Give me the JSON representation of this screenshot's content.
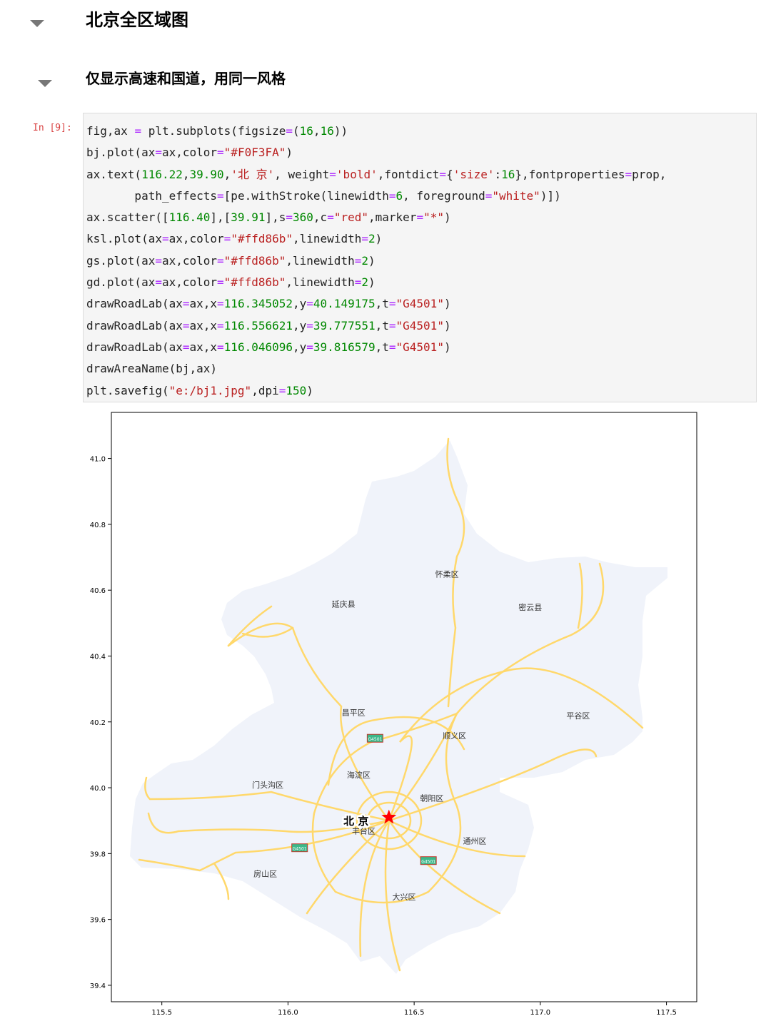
{
  "notebook": {
    "heading1": "北京全区域图",
    "heading2": "仅显示高速和国道，用同一风格",
    "prompt": "In [9]:",
    "code_lines": [
      "fig,ax = plt.subplots(figsize=(16,16))",
      "bj.plot(ax=ax,color=\"#F0F3FA\")",
      "ax.text(116.22,39.90,'北 京', weight='bold',fontdict={'size':16},fontproperties=prop,",
      "       path_effects=[pe.withStroke(linewidth=6, foreground=\"white\")])",
      "ax.scatter([116.40],[39.91],s=360,c=\"red\",marker=\"*\")",
      "ksl.plot(ax=ax,color=\"#ffd86b\",linewidth=2)",
      "gs.plot(ax=ax,color=\"#ffd86b\",linewidth=2)",
      "gd.plot(ax=ax,color=\"#ffd86b\",linewidth=2)",
      "drawRoadLab(ax=ax,x=116.345052,y=40.149175,t=\"G4501\")",
      "drawRoadLab(ax=ax,x=116.556621,y=39.777551,t=\"G4501\")",
      "drawRoadLab(ax=ax,x=116.046096,y=39.816579,t=\"G4501\")",
      "drawAreaName(bj,ax)",
      "plt.savefig(\"e:/bj1.jpg\",dpi=150)"
    ]
  },
  "chart_data": {
    "type": "map",
    "xlim": [
      115.3,
      117.62
    ],
    "ylim": [
      39.35,
      41.14
    ],
    "xticks": [
      "115.5",
      "116.0",
      "116.5",
      "117.0",
      "117.5"
    ],
    "yticks": [
      "39.4",
      "39.6",
      "39.8",
      "40.0",
      "40.2",
      "40.4",
      "40.6",
      "40.8",
      "41.0"
    ],
    "xticks_values": [
      115.5,
      116.0,
      116.5,
      117.0,
      117.5
    ],
    "yticks_values": [
      39.4,
      39.6,
      39.8,
      40.0,
      40.2,
      40.4,
      40.6,
      40.8,
      41.0
    ],
    "region_color": "#F0F3FA",
    "road_color": "#ffd86b",
    "city_label": {
      "text": "北 京",
      "x": 116.22,
      "y": 39.9
    },
    "star": {
      "x": 116.4,
      "y": 39.91,
      "color": "red"
    },
    "road_labels": [
      {
        "text": "G4501",
        "x": 116.345052,
        "y": 40.149175
      },
      {
        "text": "G4501",
        "x": 116.556621,
        "y": 39.777551
      },
      {
        "text": "G4501",
        "x": 116.046096,
        "y": 39.816579
      }
    ],
    "districts": [
      {
        "name": "怀柔区",
        "x": 116.63,
        "y": 40.64
      },
      {
        "name": "延庆县",
        "x": 116.22,
        "y": 40.55
      },
      {
        "name": "密云县",
        "x": 116.96,
        "y": 40.54
      },
      {
        "name": "昌平区",
        "x": 116.26,
        "y": 40.22
      },
      {
        "name": "平谷区",
        "x": 117.15,
        "y": 40.21
      },
      {
        "name": "顺义区",
        "x": 116.66,
        "y": 40.15
      },
      {
        "name": "海淀区",
        "x": 116.28,
        "y": 40.03
      },
      {
        "name": "门头沟区",
        "x": 115.92,
        "y": 40.0
      },
      {
        "name": "朝阳区",
        "x": 116.57,
        "y": 39.96
      },
      {
        "name": "丰台区",
        "x": 116.3,
        "y": 39.86
      },
      {
        "name": "通州区",
        "x": 116.74,
        "y": 39.83
      },
      {
        "name": "房山区",
        "x": 115.91,
        "y": 39.73
      },
      {
        "name": "大兴区",
        "x": 116.46,
        "y": 39.66
      }
    ]
  }
}
